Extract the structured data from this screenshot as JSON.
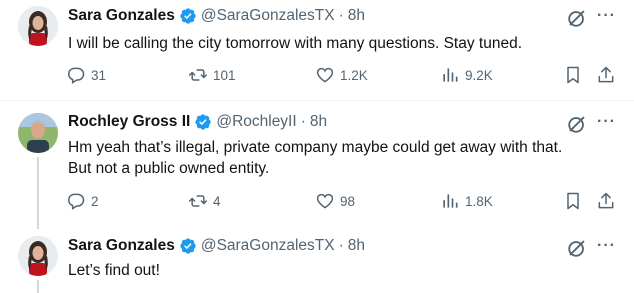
{
  "tweets": [
    {
      "name": "Sara Gonzales",
      "handle": "@SaraGonzalesTX",
      "separator": "·",
      "time": "8h",
      "text_lines": [
        "I will be calling the city tomorrow with many questions. Stay tuned."
      ],
      "replies": "31",
      "retweets": "101",
      "likes": "1.2K",
      "views": "9.2K"
    },
    {
      "name": "Rochley Gross II",
      "handle": "@RochleyII",
      "separator": "·",
      "time": "8h",
      "text_lines": [
        "Hm yeah that’s illegal, private company maybe could get away with that.",
        "But not a public owned entity."
      ],
      "replies": "2",
      "retweets": "4",
      "likes": "98",
      "views": "1.8K"
    },
    {
      "name": "Sara Gonzales",
      "handle": "@SaraGonzalesTX",
      "separator": "·",
      "time": "8h",
      "text_lines": [
        "Let’s find out!"
      ]
    }
  ],
  "colors": {
    "text": "#0f1419",
    "secondary": "#536471",
    "verified": "#1d9bf0",
    "thread_line": "#cfd9de"
  },
  "icons": [
    "reply-icon",
    "retweet-icon",
    "like-icon",
    "views-icon",
    "bookmark-icon",
    "share-icon",
    "grok-icon",
    "more-icon",
    "verified-badge-icon"
  ]
}
